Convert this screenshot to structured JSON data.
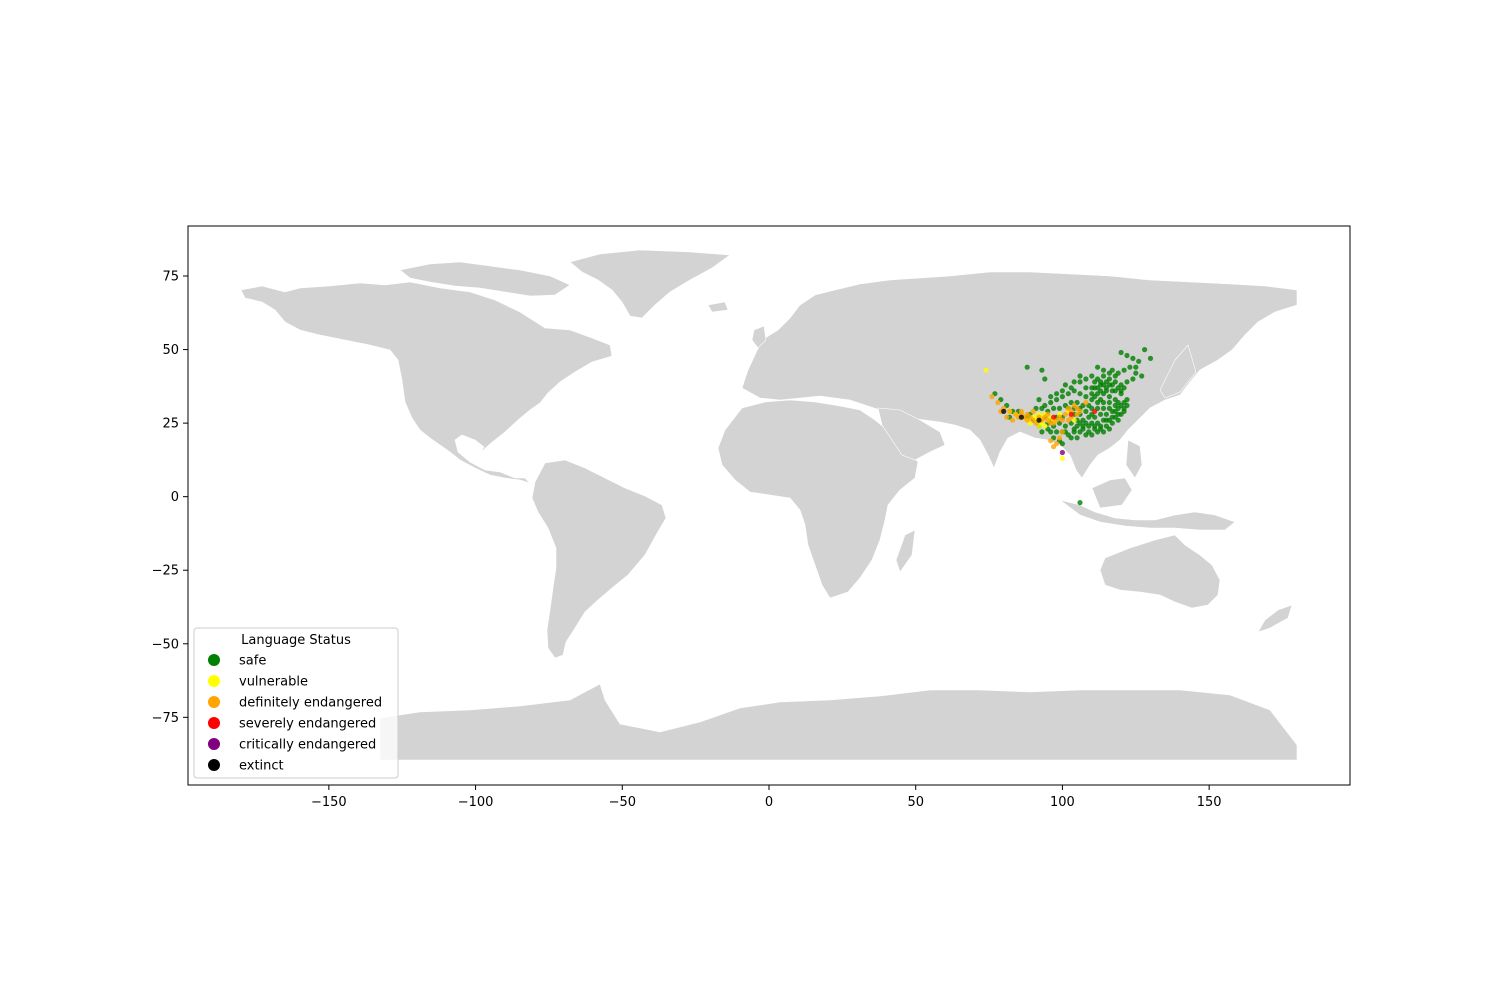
{
  "chart_data": {
    "type": "scatter",
    "title": "",
    "xlabel": "",
    "ylabel": "",
    "xlim": [
      -198,
      198
    ],
    "ylim": [
      -98,
      92
    ],
    "x_ticks": [
      -150,
      -100,
      -50,
      0,
      50,
      100,
      150
    ],
    "y_ticks": [
      -75,
      -50,
      -25,
      0,
      25,
      50,
      75
    ],
    "x_tick_labels": [
      "−150",
      "−100",
      "−50",
      "0",
      "50",
      "100",
      "150"
    ],
    "y_tick_labels": [
      "−75",
      "−50",
      "−25",
      "0",
      "25",
      "50",
      "75"
    ],
    "grid": false,
    "basemap": "world countries (light gray)",
    "land_color": "#d3d3d3",
    "legend": {
      "title": "Language Status",
      "placement": "lower-left",
      "entries": [
        {
          "label": "safe",
          "color": "#008000"
        },
        {
          "label": "vulnerable",
          "color": "#ffff00"
        },
        {
          "label": "definitely endangered",
          "color": "#ffa500"
        },
        {
          "label": "severely endangered",
          "color": "#ff0000"
        },
        {
          "label": "critically endangered",
          "color": "#800080"
        },
        {
          "label": "extinct",
          "color": "#000000"
        }
      ]
    },
    "series": [
      {
        "name": "safe",
        "color": "#008000",
        "points": [
          [
            112,
            40
          ],
          [
            114,
            41
          ],
          [
            116,
            40
          ],
          [
            118,
            39
          ],
          [
            113,
            38
          ],
          [
            111,
            37
          ],
          [
            115,
            37
          ],
          [
            117,
            36
          ],
          [
            119,
            37
          ],
          [
            112,
            35
          ],
          [
            114,
            35
          ],
          [
            116,
            34
          ],
          [
            118,
            33
          ],
          [
            120,
            35
          ],
          [
            113,
            33
          ],
          [
            110,
            33
          ],
          [
            108,
            34
          ],
          [
            106,
            35
          ],
          [
            104,
            36
          ],
          [
            110,
            30
          ],
          [
            112,
            30
          ],
          [
            114,
            30
          ],
          [
            116,
            30
          ],
          [
            118,
            31
          ],
          [
            120,
            31
          ],
          [
            121,
            30
          ],
          [
            119,
            28
          ],
          [
            117,
            27
          ],
          [
            115,
            28
          ],
          [
            113,
            28
          ],
          [
            111,
            27
          ],
          [
            109,
            27
          ],
          [
            107,
            26
          ],
          [
            105,
            26
          ],
          [
            103,
            25
          ],
          [
            101,
            24
          ],
          [
            99,
            25
          ],
          [
            97,
            24
          ],
          [
            95,
            23
          ],
          [
            113,
            23
          ],
          [
            115,
            24
          ],
          [
            117,
            25
          ],
          [
            119,
            26
          ],
          [
            111,
            23
          ],
          [
            109,
            22
          ],
          [
            107,
            23
          ],
          [
            104,
            23
          ],
          [
            112,
            25
          ],
          [
            114,
            26
          ],
          [
            116,
            26
          ],
          [
            110,
            25
          ],
          [
            108,
            25
          ],
          [
            106,
            25
          ],
          [
            112,
            32
          ],
          [
            114,
            32
          ],
          [
            116,
            32
          ],
          [
            118,
            29
          ],
          [
            115,
            39
          ],
          [
            117,
            38
          ],
          [
            113,
            39
          ],
          [
            111,
            39
          ],
          [
            110,
            37
          ],
          [
            108,
            37
          ],
          [
            106,
            30
          ],
          [
            104,
            30
          ],
          [
            102,
            30
          ],
          [
            100,
            27
          ],
          [
            98,
            27
          ],
          [
            96,
            26
          ],
          [
            94,
            27
          ],
          [
            92,
            26
          ],
          [
            90,
            26
          ],
          [
            91,
            30
          ],
          [
            93,
            30
          ],
          [
            95,
            29
          ],
          [
            97,
            30
          ],
          [
            99,
            30
          ],
          [
            101,
            31
          ],
          [
            103,
            32
          ],
          [
            105,
            32
          ],
          [
            107,
            31
          ],
          [
            109,
            31
          ],
          [
            111,
            34
          ],
          [
            113,
            36
          ],
          [
            115,
            36
          ],
          [
            119,
            32
          ],
          [
            121,
            32
          ],
          [
            122,
            31
          ],
          [
            120,
            28
          ],
          [
            118,
            27
          ],
          [
            116,
            23
          ],
          [
            114,
            22
          ],
          [
            112,
            22
          ],
          [
            110,
            21
          ],
          [
            108,
            21
          ],
          [
            106,
            22
          ],
          [
            104,
            22
          ],
          [
            102,
            21
          ],
          [
            100,
            22
          ],
          [
            98,
            22
          ],
          [
            120,
            49
          ],
          [
            122,
            48
          ],
          [
            124,
            47
          ],
          [
            126,
            46
          ],
          [
            128,
            50
          ],
          [
            130,
            47
          ],
          [
            123,
            44
          ],
          [
            125,
            44
          ],
          [
            121,
            43
          ],
          [
            119,
            42
          ],
          [
            117,
            43
          ],
          [
            112,
            44
          ],
          [
            106,
            41
          ],
          [
            103,
            37
          ],
          [
            100,
            36
          ],
          [
            88,
            44
          ],
          [
            93,
            43
          ],
          [
            94,
            40
          ],
          [
            101,
            38
          ],
          [
            98,
            33
          ],
          [
            96,
            32
          ],
          [
            94,
            31
          ],
          [
            92,
            33
          ],
          [
            85,
            29
          ],
          [
            86,
            27
          ],
          [
            88,
            27
          ],
          [
            96,
            22
          ],
          [
            97,
            20
          ],
          [
            99,
            19
          ],
          [
            100,
            18
          ],
          [
            101,
            22
          ],
          [
            103,
            20
          ],
          [
            105,
            20
          ],
          [
            106,
            -2
          ],
          [
            77,
            35
          ],
          [
            79,
            33
          ],
          [
            81,
            31
          ],
          [
            83,
            29
          ],
          [
            82,
            27
          ],
          [
            89,
            28
          ],
          [
            92,
            24
          ],
          [
            93,
            22
          ],
          [
            95,
            25
          ],
          [
            104,
            28
          ],
          [
            106,
            28
          ],
          [
            108,
            29
          ],
          [
            110,
            28
          ],
          [
            105,
            24
          ],
          [
            107,
            24
          ],
          [
            109,
            24
          ],
          [
            111,
            24
          ],
          [
            113,
            24
          ],
          [
            115,
            26
          ],
          [
            117,
            29
          ],
          [
            119,
            30
          ],
          [
            121,
            29
          ],
          [
            122,
            33
          ],
          [
            120,
            38
          ],
          [
            118,
            41
          ],
          [
            116,
            42
          ],
          [
            114,
            43
          ],
          [
            110,
            41
          ],
          [
            108,
            40
          ],
          [
            106,
            39
          ],
          [
            104,
            39
          ],
          [
            102,
            35
          ],
          [
            100,
            34
          ],
          [
            98,
            35
          ],
          [
            96,
            34
          ],
          [
            110,
            35
          ],
          [
            112,
            37
          ],
          [
            114,
            38
          ],
          [
            116,
            38
          ],
          [
            118,
            36
          ],
          [
            120,
            36
          ],
          [
            121,
            37
          ],
          [
            122,
            39
          ],
          [
            124,
            40
          ],
          [
            125,
            42
          ],
          [
            127,
            41
          ]
        ]
      },
      {
        "name": "vulnerable",
        "color": "#ffff00",
        "points": [
          [
            74,
            43
          ],
          [
            90,
            27
          ],
          [
            91,
            27
          ],
          [
            92,
            26
          ],
          [
            93,
            27
          ],
          [
            94,
            28
          ],
          [
            95,
            26
          ],
          [
            96,
            27
          ],
          [
            93,
            25
          ],
          [
            91,
            26
          ],
          [
            88,
            26
          ],
          [
            86,
            27
          ],
          [
            84,
            28
          ],
          [
            82,
            29
          ],
          [
            92,
            28
          ],
          [
            100,
            13
          ],
          [
            97,
            26
          ],
          [
            99,
            28
          ],
          [
            102,
            29
          ],
          [
            104,
            26
          ],
          [
            89,
            25
          ],
          [
            94,
            24
          ],
          [
            92,
            24
          ]
        ]
      },
      {
        "name": "definitely endangered",
        "color": "#ffa500",
        "points": [
          [
            76,
            34
          ],
          [
            78,
            32
          ],
          [
            80,
            30
          ],
          [
            82,
            29
          ],
          [
            84,
            28
          ],
          [
            85,
            27
          ],
          [
            86,
            28
          ],
          [
            87,
            27
          ],
          [
            88,
            26
          ],
          [
            89,
            27
          ],
          [
            90,
            26
          ],
          [
            91,
            25
          ],
          [
            92,
            27
          ],
          [
            93,
            26
          ],
          [
            94,
            27
          ],
          [
            95,
            26
          ],
          [
            96,
            25
          ],
          [
            97,
            25
          ],
          [
            98,
            26
          ],
          [
            99,
            27
          ],
          [
            100,
            26
          ],
          [
            101,
            28
          ],
          [
            102,
            30
          ],
          [
            103,
            29
          ],
          [
            104,
            31
          ],
          [
            105,
            30
          ],
          [
            106,
            29
          ],
          [
            108,
            32
          ],
          [
            100,
            22
          ],
          [
            99,
            20
          ],
          [
            98,
            18
          ],
          [
            97,
            17
          ],
          [
            96,
            19
          ],
          [
            103,
            27
          ],
          [
            105,
            28
          ],
          [
            102,
            26
          ],
          [
            95,
            28
          ],
          [
            83,
            26
          ],
          [
            81,
            27
          ],
          [
            79,
            29
          ],
          [
            86,
            29
          ],
          [
            88,
            28
          ],
          [
            90,
            29
          ]
        ]
      },
      {
        "name": "severely endangered",
        "color": "#ff0000",
        "points": [
          [
            111,
            29
          ],
          [
            97,
            27
          ],
          [
            103,
            28
          ]
        ]
      },
      {
        "name": "critically endangered",
        "color": "#800080",
        "points": [
          [
            100,
            15
          ]
        ]
      },
      {
        "name": "extinct",
        "color": "#000000",
        "points": [
          [
            80,
            29
          ],
          [
            86,
            27
          ],
          [
            92,
            26
          ]
        ]
      }
    ]
  }
}
